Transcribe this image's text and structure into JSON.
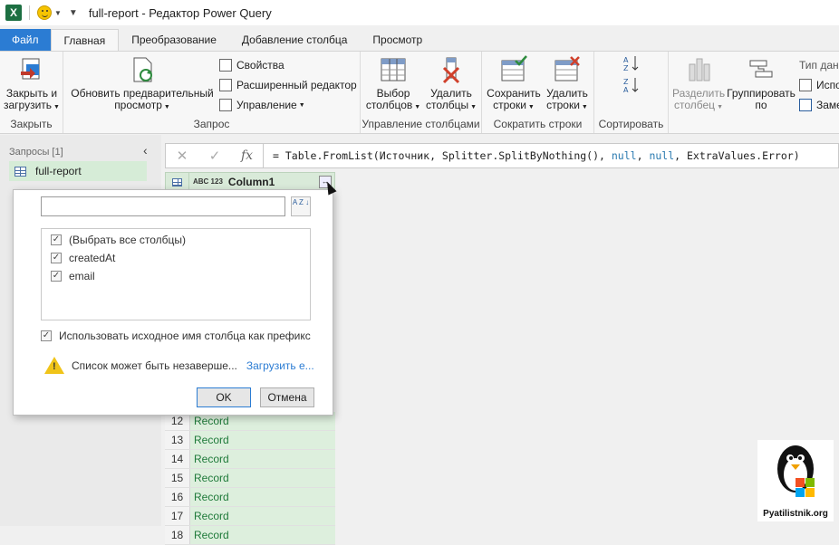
{
  "titlebar": {
    "app_logo_letter": "X",
    "title": "full-report - Редактор Power Query"
  },
  "tabs": [
    {
      "label": "Файл"
    },
    {
      "label": "Главная"
    },
    {
      "label": "Преобразование"
    },
    {
      "label": "Добавление столбца"
    },
    {
      "label": "Просмотр"
    }
  ],
  "ribbon": {
    "close_group": {
      "label": "Закрыть",
      "close_load": "Закрыть и загрузить"
    },
    "query_group": {
      "label": "Запрос",
      "refresh_preview": "Обновить предварительный просмотр",
      "properties": "Свойства",
      "advanced_editor": "Расширенный редактор",
      "manage": "Управление"
    },
    "manage_columns_group": {
      "label": "Управление столбцами",
      "choose_columns": "Выбор столбцов",
      "remove_columns": "Удалить столбцы"
    },
    "reduce_rows_group": {
      "label": "Сократить строки",
      "keep_rows": "Сохранить строки",
      "remove_rows": "Удалить строки"
    },
    "sort_group": {
      "label": "Сортировать"
    },
    "transform_group": {
      "split_column": "Разделить столбец",
      "group_by": "Группировать по",
      "data_type": "Тип данн",
      "use_first_row": "Испо",
      "replace": "Заме"
    }
  },
  "left_panel": {
    "title": "Запросы [1]",
    "query": "full-report"
  },
  "formula_bar": {
    "cancel_glyph": "✕",
    "confirm_glyph": "✓",
    "fx": "fx",
    "formula_prefix": "= Table.FromList(Источник, Splitter.SplitByNothing(), ",
    "null1": "null",
    "sep": ", ",
    "null2": "null",
    "formula_suffix": ", ExtraValues.Error)"
  },
  "grid": {
    "column_type_label": "ABC 123",
    "column_name": "Column1",
    "expand_glyph": "↔",
    "rows": [
      {
        "num": "12",
        "value": "Record"
      },
      {
        "num": "13",
        "value": "Record"
      },
      {
        "num": "14",
        "value": "Record"
      },
      {
        "num": "15",
        "value": "Record"
      },
      {
        "num": "16",
        "value": "Record"
      },
      {
        "num": "17",
        "value": "Record"
      },
      {
        "num": "18",
        "value": "Record"
      }
    ]
  },
  "popup": {
    "search_value": "",
    "sort_glyph": "A Z ↓",
    "check_glyph": "✓",
    "options": [
      {
        "label": "(Выбрать все столбцы)",
        "checked": true
      },
      {
        "label": "createdAt",
        "checked": true
      },
      {
        "label": "email",
        "checked": true
      }
    ],
    "prefix_label": "Использовать исходное имя столбца как префикс",
    "warning_glyph": "!",
    "warning_text": "Список может быть незаверше...",
    "load_more_link": "Загрузить е...",
    "ok": "OK",
    "cancel": "Отмена"
  },
  "watermark": {
    "text": "Pyatilistnik.org"
  },
  "colors": {
    "accent": "#2b7cd3",
    "excel_green": "#1d6f42",
    "record_green": "#1f7a3a"
  }
}
